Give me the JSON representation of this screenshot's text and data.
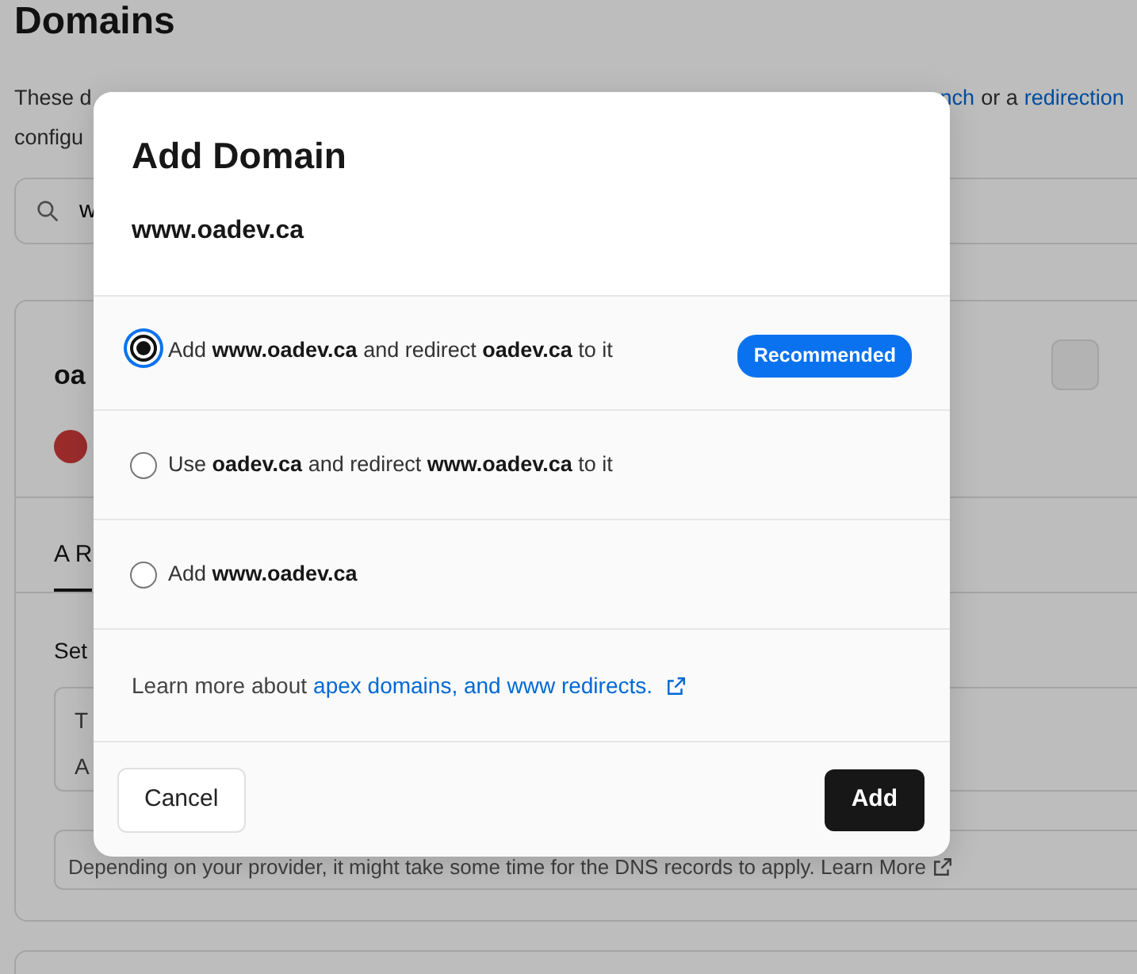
{
  "page": {
    "title": "Domains",
    "description": [
      {
        "kind": "text",
        "text": "These d"
      },
      {
        "kind": "gap"
      },
      {
        "kind": "link",
        "text": "nch"
      },
      {
        "kind": "text",
        "text": "or a"
      },
      {
        "kind": "link",
        "text": "redirection"
      }
    ],
    "description_line2": "configu",
    "search": {
      "value": "w"
    },
    "domain_card": {
      "name": "oa",
      "tab": {
        "label": "A R",
        "selected": true
      },
      "instruction": "Set",
      "record_header": "T",
      "record_type": "A",
      "notice": "Depending on your provider, it might take some time for the DNS records to apply. Learn More"
    }
  },
  "dialog": {
    "title": "Add Domain",
    "domain": "www.oadev.ca",
    "options": [
      {
        "label": "Add **www.oadev.ca** and redirect **oadev.ca** to it",
        "selected": true,
        "badge": "Recommended"
      },
      {
        "label": "Use **oadev.ca** and redirect **www.oadev.ca** to it",
        "selected": false
      },
      {
        "label": "Add **www.oadev.ca**",
        "selected": false
      }
    ],
    "learn_more": {
      "text": "Learn more about",
      "link": "apex domains, and www redirects."
    },
    "buttons": [
      {
        "kind": "secondary",
        "label": "Cancel"
      },
      {
        "kind": "primary",
        "label": "Add"
      }
    ]
  }
}
